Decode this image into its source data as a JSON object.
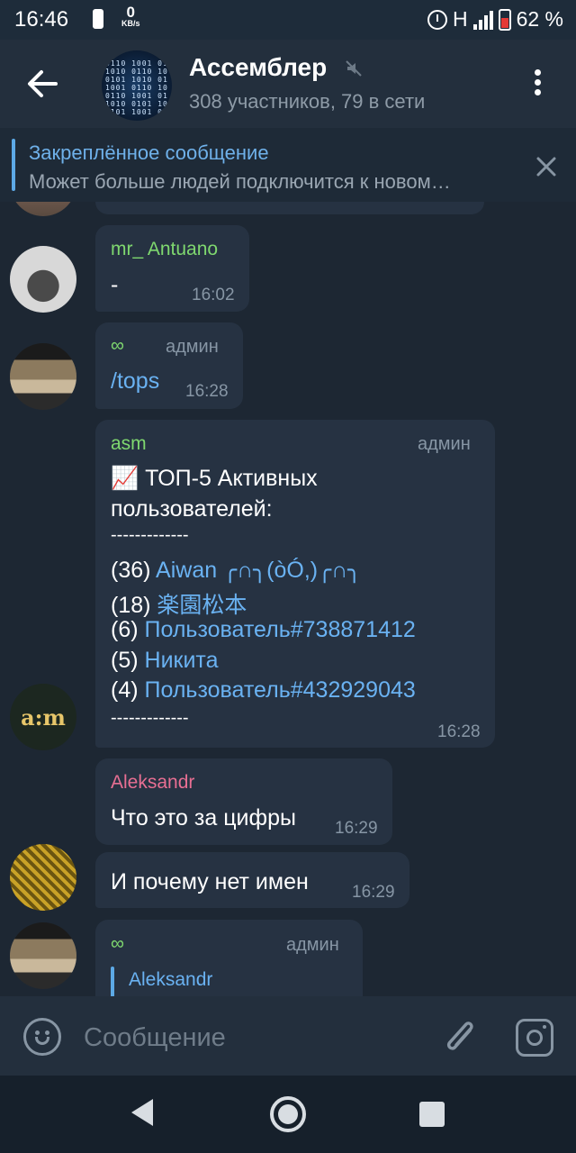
{
  "status_bar": {
    "time": "16:46",
    "net_speed_value": "0",
    "net_speed_unit": "KB/s",
    "network_type": "H",
    "battery": "62 %"
  },
  "header": {
    "title": "Ассемблер",
    "subtitle": "308 участников, 79 в сети",
    "avatar_code_lines": [
      "0110 1001 0110 10",
      "1010 0110 1001 0101",
      "0101 1010 0110 1001 01",
      "1001 0110 1010 0101 10",
      "0110 1001 0101 1010 01",
      "1010 0101 1001 0110",
      "0101 1001 0110 10"
    ]
  },
  "pinned": {
    "title": "Закреплённое сообщение",
    "text": "Может больше людей подключится к новом…"
  },
  "messages": {
    "m1": {
      "sender": "mr_ Antuano",
      "text": "-",
      "time": "16:02"
    },
    "m2": {
      "sender": "∞",
      "role": "админ",
      "text": "/tops",
      "time": "16:28"
    },
    "m3": {
      "sender": "asm",
      "role": "админ",
      "line1": "📈 ТОП-5 Активных",
      "line2": "пользователей:",
      "sep1": "-------------",
      "r1_count": "(36)",
      "r1_name": "Aiwan ╭∩╮(òÓ,)╭∩╮",
      "r2_count": "(18)",
      "r2_name": "楽園松本",
      "r3_count": "(6)",
      "r3_name": "Пользователь#738871412",
      "r4_count": "(5)",
      "r4_name": "Никита",
      "r5_count": "(4)",
      "r5_name": "Пользователь#432929043",
      "sep2": "-------------",
      "time": "16:28",
      "avatar_text": "a:m"
    },
    "m4": {
      "sender": "Aleksandr",
      "text": "Что это за цифры",
      "time": "16:29"
    },
    "m5": {
      "text": "И почему нет имен",
      "time": "16:29"
    },
    "m6": {
      "sender": "∞",
      "role": "админ",
      "reply_sender": "Aleksandr"
    }
  },
  "input": {
    "placeholder": "Сообщение"
  },
  "colors": {
    "bg": "#1d2733",
    "bubble": "#263242",
    "link": "#6ab2f2",
    "name_green": "#7fd86f",
    "name_pink": "#e86f93",
    "pinned_title": "#6fb1ea"
  }
}
